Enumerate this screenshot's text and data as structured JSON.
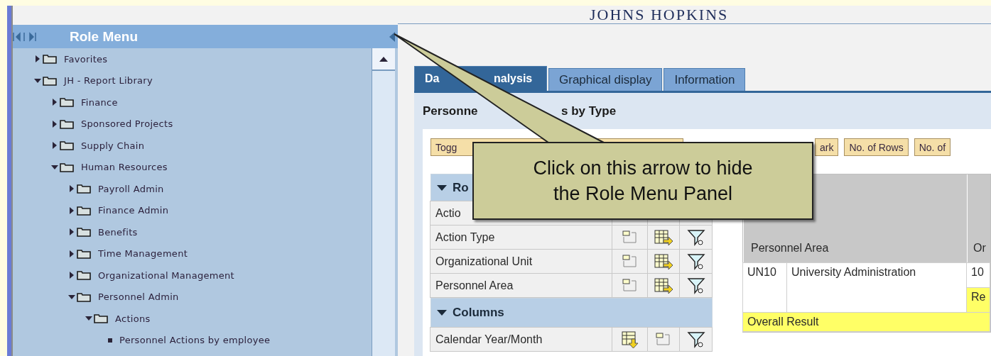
{
  "logo": "JOHNS HOPKINS",
  "role_menu": {
    "title": "Role Menu",
    "tree": [
      {
        "label": "Favorites",
        "expanded": false
      },
      {
        "label": "JH - Report Library",
        "expanded": true,
        "children": [
          {
            "label": "Finance",
            "expanded": false
          },
          {
            "label": "Sponsored Projects",
            "expanded": false
          },
          {
            "label": "Supply Chain",
            "expanded": false
          },
          {
            "label": "Human Resources",
            "expanded": true,
            "children": [
              {
                "label": "Payroll Admin",
                "expanded": false
              },
              {
                "label": "Finance Admin",
                "expanded": false
              },
              {
                "label": "Benefits",
                "expanded": false
              },
              {
                "label": "Time Management",
                "expanded": false
              },
              {
                "label": "Organizational Management",
                "expanded": false
              },
              {
                "label": "Personnel Admin",
                "expanded": true,
                "children": [
                  {
                    "label": "Actions",
                    "expanded": true,
                    "children": [
                      {
                        "label": "Personnel Actions by employee",
                        "kind": "leaf"
                      }
                    ]
                  }
                ]
              }
            ]
          }
        ]
      }
    ]
  },
  "tabs": [
    {
      "label_parts": [
        "Da",
        "nalysis"
      ],
      "selected": true
    },
    {
      "label_parts": [
        "Graphical display"
      ],
      "selected": false
    },
    {
      "label_parts": [
        "Information"
      ],
      "selected": false
    }
  ],
  "report": {
    "title_parts": [
      "Personne",
      "s by Type"
    ],
    "toolbar": [
      {
        "label": "Togg"
      },
      {
        "label": "ark"
      },
      {
        "label": "No. of Rows"
      },
      {
        "label": "No. of"
      }
    ],
    "navigation": [
      {
        "header": "Ro",
        "kind": "rows",
        "items": [
          {
            "label": "Actio",
            "icons": false
          },
          {
            "label": "Action Type",
            "icons": true
          },
          {
            "label": "Organizational Unit",
            "icons": true
          },
          {
            "label": "Personnel Area",
            "icons": true
          }
        ]
      },
      {
        "header": "Columns",
        "kind": "columns",
        "items": [
          {
            "label": "Calendar Year/Month",
            "icons": true
          }
        ]
      }
    ],
    "table": {
      "header": "Personnel Area",
      "column_3": "Or",
      "rows": [
        {
          "code": "UN10",
          "name": "University Administration",
          "value": "10",
          "subtotal": "Re"
        }
      ],
      "overall": "Overall Result"
    }
  },
  "callout": {
    "lines": [
      "Click on this arrow to hide",
      "the Role Menu Panel"
    ]
  }
}
